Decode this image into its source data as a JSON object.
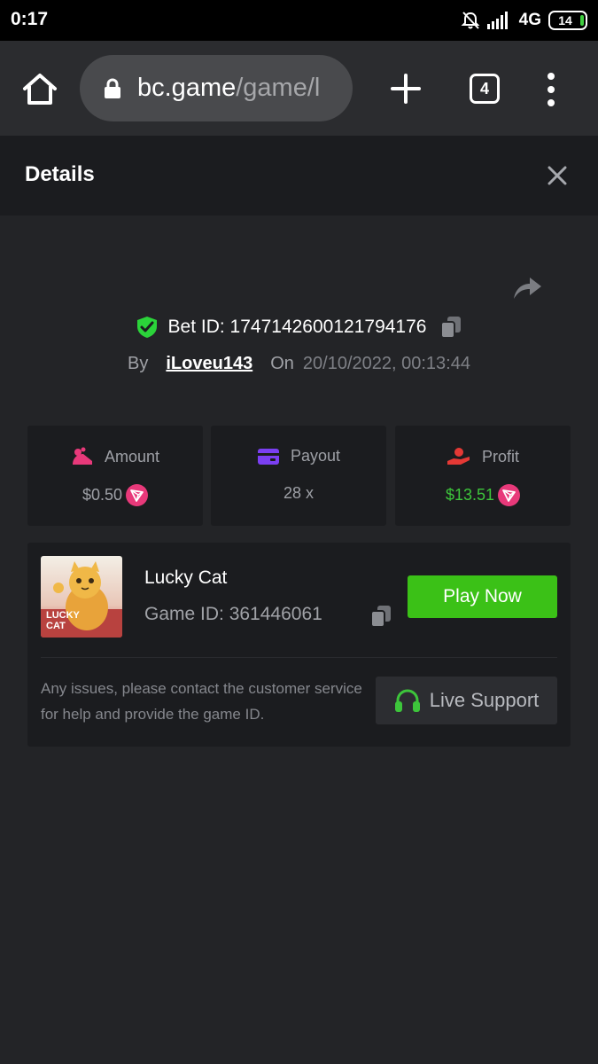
{
  "status_bar": {
    "time": "0:17",
    "network": "4G",
    "battery": "14"
  },
  "browser": {
    "url_domain": "bc.game",
    "url_path": "/game/l",
    "tab_count": "4",
    "icons": [
      "home-icon",
      "lock-icon",
      "plus-icon",
      "tabs-icon",
      "more-vert-icon"
    ]
  },
  "details": {
    "title": "Details"
  },
  "bet": {
    "bet_id_label": "Bet ID: 1747142600121794176",
    "by_label": "By",
    "username": "iLoveu143",
    "on_label": "On",
    "datetime": "20/10/2022, 00:13:44"
  },
  "stats": {
    "amount": {
      "label": "Amount",
      "value": "$0.50"
    },
    "payout": {
      "label": "Payout",
      "value": "28 x"
    },
    "profit": {
      "label": "Profit",
      "value": "$13.51"
    }
  },
  "game": {
    "name": "Lucky Cat",
    "game_id_label": "Game ID: 361446061",
    "thumb_text_line1": "LUCKY",
    "thumb_text_line2": "CAT",
    "play_label": "Play Now",
    "help_text": "Any issues, please contact the customer service for help and provide the game ID.",
    "support_label": "Live Support"
  },
  "colors": {
    "background": "#232427",
    "card": "#1b1c1f",
    "accent_green": "#3bc117",
    "profit_green": "#3dc53b",
    "shield_green": "#2bd33a",
    "amount_icon": "#e8397a",
    "payout_icon": "#7b3ff2",
    "profit_icon": "#e53935",
    "tron_coin": "#e8397a"
  }
}
